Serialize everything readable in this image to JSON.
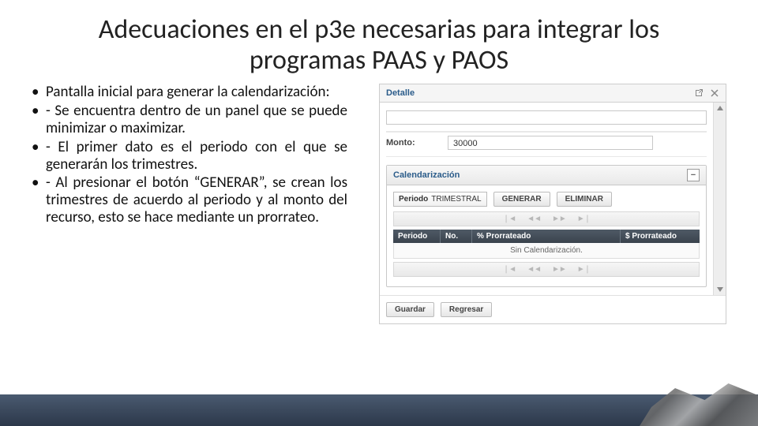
{
  "title": "Adecuaciones en el p3e necesarias para integrar los programas PAAS y PAOS",
  "bullets": [
    "Pantalla inicial para generar la calendarización:",
    "-      Se encuentra dentro de un panel que se puede minimizar o maximizar.",
    "-      El primer dato es el periodo con el que se generarán los trimestres.",
    "-      Al presionar el botón “GENERAR”, se crean los trimestres de acuerdo al periodo y al monto del recurso, esto se hace mediante un prorrateo."
  ],
  "panel": {
    "detalle_title": "Detalle",
    "monto_label": "Monto:",
    "monto_value": "30000",
    "cal_title": "Calendarización",
    "collapse_symbol": "−",
    "period_label": "Periodo",
    "period_value": "TRIMESTRAL",
    "btn_generar": "GENERAR",
    "btn_eliminar": "ELIMINAR",
    "nav": {
      "first": "❘◄",
      "prev": "◄◄",
      "next": "►►",
      "last": "►❘"
    },
    "grid_cols": {
      "c1": "Periodo",
      "c2": "No.",
      "c3": "% Prorrateado",
      "c4": "$ Prorrateado"
    },
    "grid_empty": "Sin Calendarización.",
    "btn_guardar": "Guardar",
    "btn_regresar": "Regresar"
  }
}
